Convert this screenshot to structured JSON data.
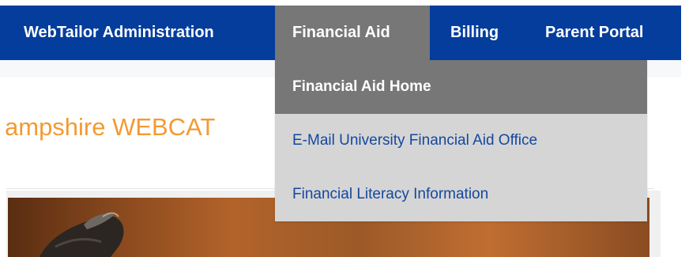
{
  "navbar": {
    "items": [
      {
        "label": "WebTailor Administration",
        "active": false
      },
      {
        "label": "Financial Aid",
        "active": true
      },
      {
        "label": "Billing",
        "active": false
      },
      {
        "label": "Parent Portal",
        "active": false
      }
    ]
  },
  "dropdown": {
    "items": [
      {
        "label": "Financial Aid Home",
        "highlighted": true
      },
      {
        "label": "E-Mail University Financial Aid Office",
        "highlighted": false
      },
      {
        "label": "Financial Literacy Information",
        "highlighted": false
      }
    ]
  },
  "page": {
    "heading": "ampshire WEBCAT"
  },
  "colors": {
    "navbar_bg": "#043d9c",
    "active_bg": "#777777",
    "dropdown_bg": "#d5d5d5",
    "link_blue": "#14479f",
    "heading_orange": "#f39a33"
  }
}
